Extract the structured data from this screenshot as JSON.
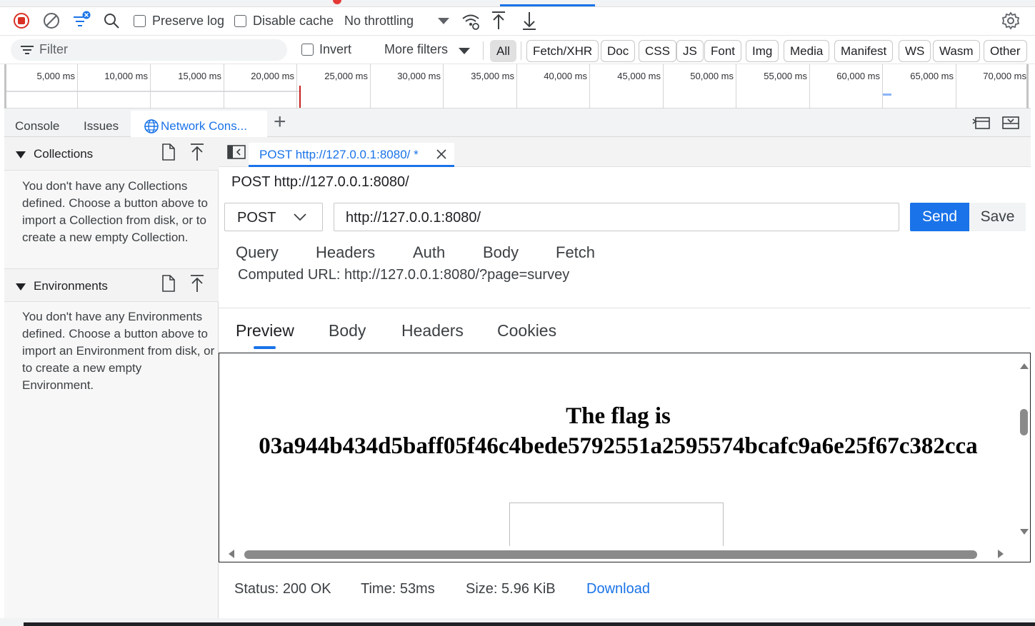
{
  "toolbar": {
    "record_icon": "record-stop-icon",
    "clear_icon": "clear-icon",
    "preserve_log": "Preserve log",
    "disable_cache": "Disable cache",
    "throttling": "No throttling",
    "settings_icon": "gear-icon"
  },
  "filterbar": {
    "filter_placeholder": "Filter",
    "invert": "Invert",
    "more_filters": "More filters",
    "chips": [
      "All",
      "Fetch/XHR",
      "Doc",
      "CSS",
      "JS",
      "Font",
      "Img",
      "Media",
      "Manifest",
      "WS",
      "Wasm",
      "Other"
    ],
    "active_chip": "All"
  },
  "timeline": {
    "ticks": [
      "5,000 ms",
      "10,000 ms",
      "15,000 ms",
      "20,000 ms",
      "25,000 ms",
      "30,000 ms",
      "35,000 ms",
      "40,000 ms",
      "45,000 ms",
      "50,000 ms",
      "55,000 ms",
      "60,000 ms",
      "65,000 ms",
      "70,000 ms"
    ]
  },
  "drawer": {
    "tabs": [
      "Console",
      "Issues",
      "Network Cons..."
    ],
    "add_tab": "+"
  },
  "sidebar": {
    "collections_title": "Collections",
    "collections_text": "You don't have any Collections defined. Choose a button above to import a Collection from disk, or to create a new empty Collection.",
    "environments_title": "Environments",
    "environments_text": "You don't have any Environments defined. Choose a button above to import an Environment from disk, or to create a new empty Environment."
  },
  "request": {
    "tab_title": "POST http://127.0.0.1:8080/ *",
    "heading": "POST http://127.0.0.1:8080/",
    "method": "POST",
    "url": "http://127.0.0.1:8080/",
    "send": "Send",
    "save": "Save",
    "subtabs": [
      "Query",
      "Headers",
      "Auth",
      "Body",
      "Fetch"
    ],
    "computed_url": "Computed URL: http://127.0.0.1:8080/?page=survey"
  },
  "response": {
    "tabs": [
      "Preview",
      "Body",
      "Headers",
      "Cookies"
    ],
    "active_tab": "Preview",
    "flag_line1": "The flag is",
    "flag_line2": "03a944b434d5baff05f46c4bede5792551a2595574bcafc9a6e25f67c382cca",
    "status": "Status: 200 OK",
    "time": "Time: 53ms",
    "size": "Size: 5.96 KiB",
    "download": "Download"
  },
  "colors": {
    "accent": "#1a73e8",
    "send_button": "#1a73e8",
    "record": "#d93025"
  }
}
